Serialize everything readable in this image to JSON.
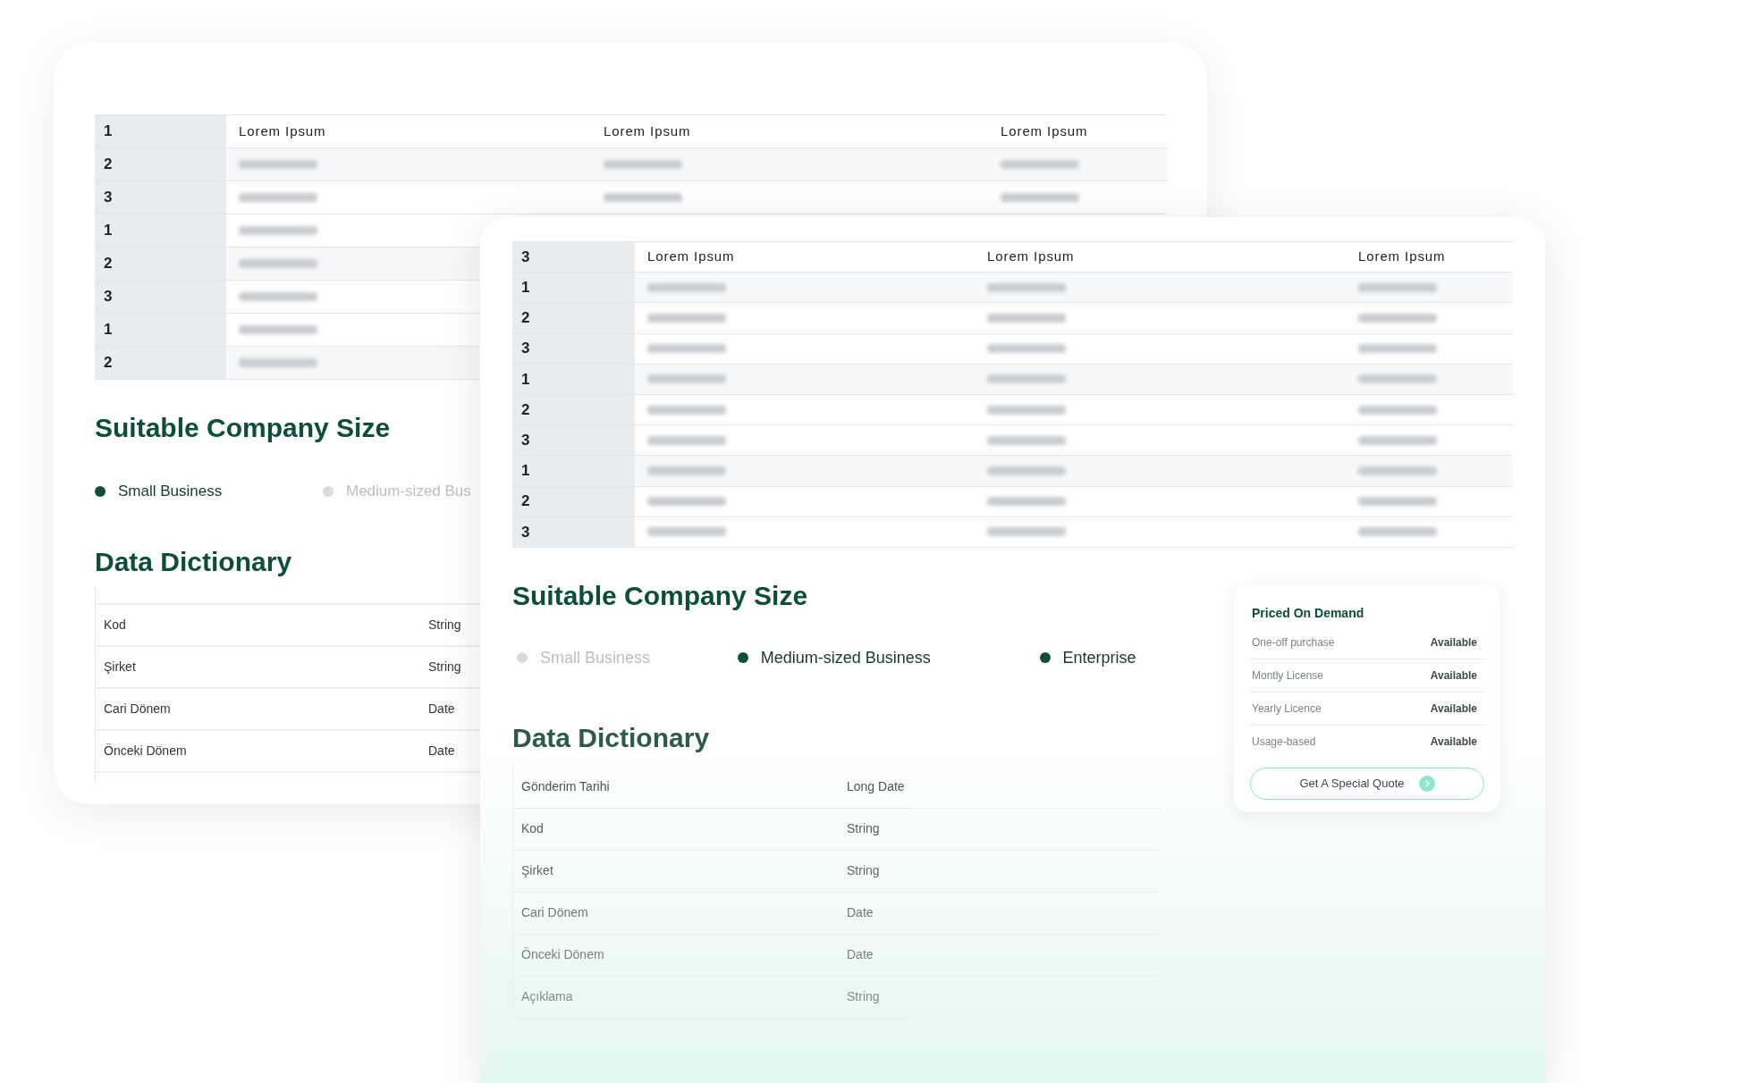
{
  "back_card": {
    "table": {
      "header_index": "1",
      "columns": [
        "Lorem Ipsum",
        "Lorem Ipsum",
        "Lorem Ipsum"
      ],
      "row_indexes": [
        "2",
        "3",
        "1",
        "2",
        "3",
        "1",
        "2"
      ]
    },
    "company_size": {
      "title": "Suitable Company Size",
      "options": [
        {
          "label": "Small Business",
          "active": true
        },
        {
          "label": "Medium-sized Bus",
          "active": false
        }
      ]
    },
    "data_dictionary": {
      "title": "Data Dictionary",
      "rows": [
        {
          "name": "Kod",
          "type": "String"
        },
        {
          "name": "Şirket",
          "type": "String"
        },
        {
          "name": "Cari Dönem",
          "type": "Date"
        },
        {
          "name": "Önceki Dönem",
          "type": "Date"
        }
      ]
    }
  },
  "front_card": {
    "table": {
      "header_index": "3",
      "columns": [
        "Lorem Ipsum",
        "Lorem Ipsum",
        "Lorem Ipsum"
      ],
      "row_indexes": [
        "1",
        "2",
        "3",
        "1",
        "2",
        "3",
        "1",
        "2",
        "3"
      ]
    },
    "company_size": {
      "title": "Suitable Company Size",
      "options": [
        {
          "label": "Small Business",
          "active": false
        },
        {
          "label": "Medium-sized Business",
          "active": true
        },
        {
          "label": "Enterprise",
          "active": true
        }
      ]
    },
    "data_dictionary": {
      "title": "Data Dictionary",
      "rows": [
        {
          "name": "Gönderim Tarihi",
          "type": "Long Date"
        },
        {
          "name": "Kod",
          "type": "String"
        },
        {
          "name": "Şirket",
          "type": "String"
        },
        {
          "name": "Cari Dönem",
          "type": "Date"
        },
        {
          "name": "Önceki Dönem",
          "type": "Date"
        },
        {
          "name": "Açıklama",
          "type": "String"
        }
      ]
    },
    "pricing": {
      "title": "Priced On Demand",
      "rows": [
        {
          "label": "One-off purchase",
          "value": "Available"
        },
        {
          "label": "Montly License",
          "value": "Available"
        },
        {
          "label": "Yearly Licence",
          "value": "Available"
        },
        {
          "label": "Usage-based",
          "value": "Available"
        }
      ],
      "button": "Get A Special Quote"
    }
  }
}
